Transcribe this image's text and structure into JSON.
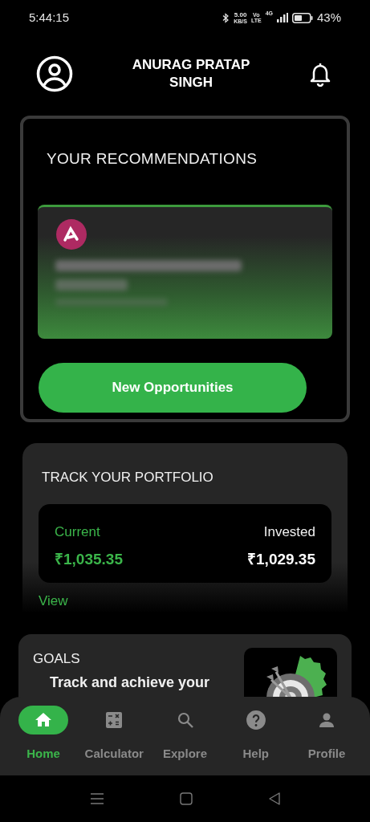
{
  "status_bar": {
    "time": "5:44:15",
    "speed": "5.00",
    "speed_unit": "KB/S",
    "volte_top": "Vo",
    "volte_bottom": "LTE",
    "network": "4G",
    "battery": "43%"
  },
  "header": {
    "name": "ANURAG PRATAP SINGH"
  },
  "recommendations": {
    "title": "YOUR RECOMMENDATIONS",
    "button": "New Opportunities"
  },
  "portfolio": {
    "title": "TRACK YOUR PORTFOLIO",
    "current_label": "Current",
    "current_value": "₹1,035.35",
    "invested_label": "Invested",
    "invested_value": "₹1,029.35",
    "link": "View"
  },
  "goals": {
    "title": "GOALS",
    "text": "Track and achieve your"
  },
  "tabs": [
    {
      "label": "Home",
      "kind": "home",
      "selected": true
    },
    {
      "label": "Calculator",
      "kind": "calculator",
      "selected": false
    },
    {
      "label": "Explore",
      "kind": "search",
      "selected": false
    },
    {
      "label": "Help",
      "kind": "help",
      "selected": false
    },
    {
      "label": "Profile",
      "kind": "profile",
      "selected": false
    }
  ]
}
